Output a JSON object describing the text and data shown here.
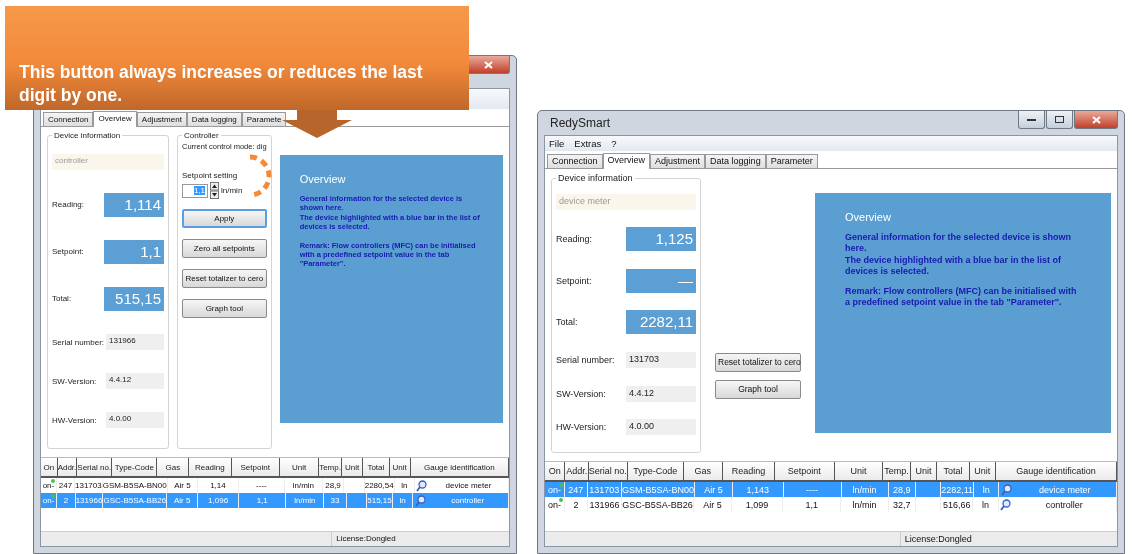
{
  "callout": {
    "text": "This button always increases or reduces the last digit by one."
  },
  "windows": [
    {
      "tabs": [
        {
          "label": "Connection",
          "selected": false
        },
        {
          "label": "Overview",
          "selected": true
        },
        {
          "label": "Adjustment",
          "selected": false
        },
        {
          "label": "Data logging",
          "selected": false
        },
        {
          "label": "Paramete",
          "selected": false
        }
      ],
      "device_info": {
        "heading": "Device information",
        "name": "controller",
        "big_values": [
          {
            "label": "Reading:",
            "value": "1,114"
          },
          {
            "label": "Setpoint:",
            "value": "1,1"
          },
          {
            "label": "Total:",
            "value": "515,15"
          }
        ],
        "fields": [
          {
            "label": "Serial number:",
            "value": "131966"
          },
          {
            "label": "SW-Version:",
            "value": "4.4.12"
          },
          {
            "label": "HW-Version:",
            "value": "4.0.00"
          }
        ]
      },
      "controller": {
        "heading": "Controller",
        "mode": "Current control mode: dig",
        "setpoint_label": "Setpoint setting",
        "setpoint_value": "1,1",
        "unit": "ln/min"
      },
      "buttons": [
        "Apply",
        "Zero all setpoints",
        "Reset totalizer to cero",
        "Graph tool"
      ],
      "overview": {
        "title": "Overview",
        "paragraphs": [
          "General information for the selected device is shown here.\nThe device highlighted with a blue bar in the list of devices is selected.",
          "Remark: Flow controllers (MFC) can be initialised with a predefined setpoint value in the tab \"Parameter\"."
        ]
      },
      "table": {
        "columns": [
          "On",
          "Addr.",
          "Serial no.",
          "Type-Code",
          "Gas",
          "Reading",
          "Setpoint",
          "Unit",
          "Temp.",
          "Unit",
          "Total",
          "Unit",
          "Gauge identification"
        ],
        "rows": [
          {
            "selected": false,
            "on": "on-",
            "addr": "247",
            "serial": "131703",
            "type_code": "GSM-B5SA-BN00",
            "gas": "Air 5",
            "reading": "1,14",
            "setpoint": "----",
            "unit": "ln/min",
            "temp": "28,9",
            "total": "2280,54",
            "total_unit": "ln",
            "gauge": "device meter"
          },
          {
            "selected": true,
            "on": "on-",
            "addr": "2",
            "serial": "131966",
            "type_code": "GSC-B5SA-BB26",
            "gas": "Air 5",
            "reading": "1,096",
            "setpoint": "1,1",
            "unit": "ln/min",
            "temp": "33",
            "total": "515,15",
            "total_unit": "ln",
            "gauge": "controller"
          }
        ]
      },
      "status": "License:Dongled"
    },
    {
      "title": "RedySmart",
      "menu": [
        "File",
        "Extras",
        "?"
      ],
      "tabs": [
        {
          "label": "Connection",
          "selected": false
        },
        {
          "label": "Overview",
          "selected": true
        },
        {
          "label": "Adjustment",
          "selected": false
        },
        {
          "label": "Data logging",
          "selected": false
        },
        {
          "label": "Parameter",
          "selected": false
        }
      ],
      "device_info": {
        "heading": "Device information",
        "name": "device meter",
        "big_values": [
          {
            "label": "Reading:",
            "value": "1,125"
          },
          {
            "label": "Setpoint:",
            "value": "—"
          },
          {
            "label": "Total:",
            "value": "2282,11"
          }
        ],
        "fields": [
          {
            "label": "Serial number:",
            "value": "131703"
          },
          {
            "label": "SW-Version:",
            "value": "4.4.12"
          },
          {
            "label": "HW-Version:",
            "value": "4.0.00"
          }
        ]
      },
      "buttons": [
        "Reset totalizer to cero",
        "Graph tool"
      ],
      "overview": {
        "title": "Overview",
        "paragraphs": [
          "General information for the selected device is shown here.\nThe device highlighted with a blue bar in the list of devices is selected.",
          "Remark: Flow controllers (MFC) can be initialised with a predefined setpoint value in the tab \"Parameter\"."
        ]
      },
      "table": {
        "columns": [
          "On",
          "Addr.",
          "Serial no.",
          "Type-Code",
          "Gas",
          "Reading",
          "Setpoint",
          "Unit",
          "Temp.",
          "Unit",
          "Total",
          "Unit",
          "Gauge identification"
        ],
        "rows": [
          {
            "selected": true,
            "on": "on-",
            "addr": "247",
            "serial": "131703",
            "type_code": "GSM-B5SA-BN00",
            "gas": "Air 5",
            "reading": "1,143",
            "setpoint": "----",
            "unit": "ln/min",
            "temp": "28,9",
            "total": "2282,11",
            "total_unit": "ln",
            "gauge": "device meter"
          },
          {
            "selected": false,
            "on": "on-",
            "addr": "2",
            "serial": "131966",
            "type_code": "GSC-B5SA-BB26",
            "gas": "Air 5",
            "reading": "1,099",
            "setpoint": "1,1",
            "unit": "ln/min",
            "temp": "32,7",
            "total": "516,66",
            "total_unit": "ln",
            "gauge": "controller"
          }
        ]
      },
      "status": "License:Dongled"
    }
  ]
}
